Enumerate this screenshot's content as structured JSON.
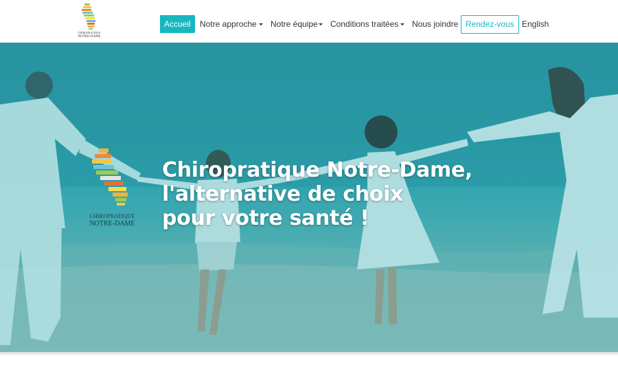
{
  "brand": {
    "logo_line1": "CHIROPRATIQUE",
    "logo_line2": "NOTRE-DAME"
  },
  "nav": {
    "items": [
      {
        "label": "Accueil",
        "active": true,
        "dropdown": false
      },
      {
        "label": "Notre approche",
        "active": false,
        "dropdown": true
      },
      {
        "label": "Notre équipe",
        "active": false,
        "dropdown": true
      },
      {
        "label": "Conditions traitées",
        "active": false,
        "dropdown": true
      },
      {
        "label": "Nous joindre",
        "active": false,
        "dropdown": false
      },
      {
        "label": "Rendez-vous",
        "active": false,
        "dropdown": false,
        "outlined": true
      },
      {
        "label": "English",
        "active": false,
        "dropdown": false
      }
    ]
  },
  "hero": {
    "title_lines": [
      "Chiropratique Notre-Dame,",
      "l'alternative de choix",
      "pour votre santé !"
    ],
    "logo_line1": "CHIROPRATIQUE",
    "logo_line2": "NOTRE-DAME"
  },
  "colors": {
    "accent": "#17b7c0",
    "hero_overlay": "#2f94a0",
    "logo_bars": [
      "#f2c84b",
      "#eb8b3a",
      "#6ec3d9",
      "#9ccc54",
      "#f1e04a",
      "#e76f3b",
      "#5fb8d4",
      "#f3b13b"
    ]
  }
}
